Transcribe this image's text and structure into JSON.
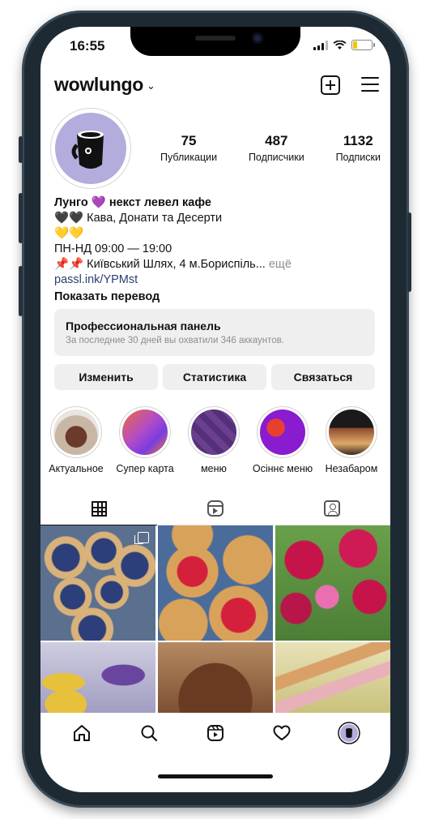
{
  "status_bar": {
    "time": "16:55"
  },
  "header": {
    "username": "wowlungo",
    "chevron": "⌄"
  },
  "stats": [
    {
      "value": "75",
      "label": "Публикации"
    },
    {
      "value": "487",
      "label": "Подписчики"
    },
    {
      "value": "1132",
      "label": "Подписки"
    }
  ],
  "bio": {
    "name": "Лунго 💜 некст левел кафе",
    "line1": "🖤🖤 Кава, Донати та Десерти",
    "line2": "💛💛",
    "line3": "ПН-НД 09:00 — 19:00",
    "line4": "📌📌 Київський Шлях, 4 м.Бориспіль...",
    "more": " ещё",
    "link": "passl.ink/YPMst",
    "translate": "Показать перевод"
  },
  "pro_panel": {
    "title": "Профессиональная панель",
    "subtitle": "За последние 30 дней вы охватили 346 аккаунтов."
  },
  "actions": {
    "edit": "Изменить",
    "stats": "Статистика",
    "contact": "Связаться"
  },
  "highlights": [
    {
      "label": "Актуальное"
    },
    {
      "label": "Супер карта"
    },
    {
      "label": "меню"
    },
    {
      "label": "Осіннє меню"
    },
    {
      "label": "Незабаром"
    }
  ],
  "tabs": [
    "grid-icon",
    "reels-icon",
    "tagged-icon"
  ],
  "bottom_nav": [
    "home-icon",
    "search-icon",
    "reels-icon",
    "heart-icon",
    "profile-avatar"
  ],
  "colors": {
    "avatar_bg": "#b3addd",
    "link": "#2c3e72",
    "muted": "#8e8e8e",
    "panel_bg": "#efefef"
  }
}
